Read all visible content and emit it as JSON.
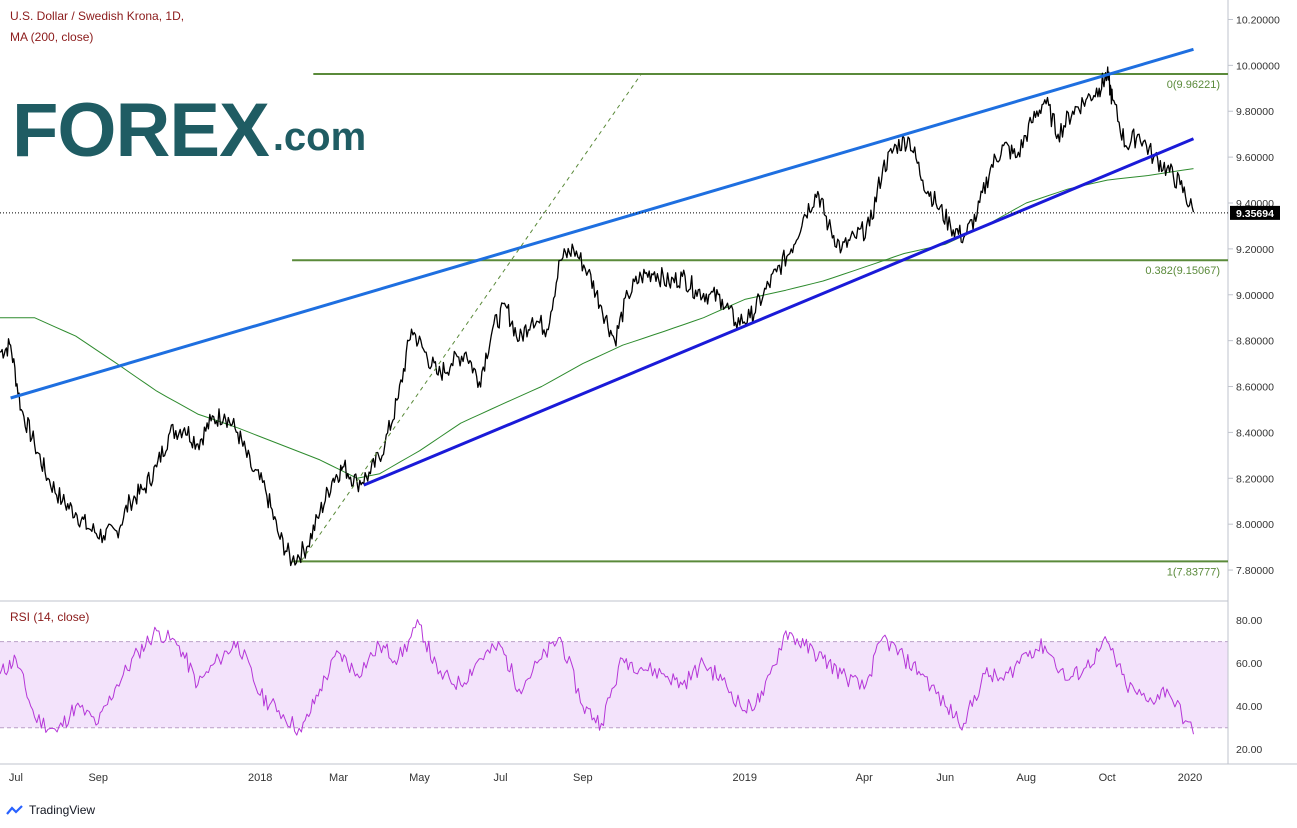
{
  "header": {
    "title": "U.S. Dollar / Swedish Krona, 1D,",
    "indicator": "MA (200, close)",
    "rsi_label": "RSI (14, close)"
  },
  "logo": {
    "big": "FOREX",
    "small": ".com"
  },
  "footer": {
    "brand": "TradingView"
  },
  "colors": {
    "price": "#000000",
    "ma": "#2e8b2e",
    "upper_trend": "#1e6fe0",
    "lower_trend": "#1a1ad8",
    "fib": "#5a8a3a",
    "rsi": "#b536d8",
    "rsi_band": "#f3e3fb",
    "title": "#8b1a1a",
    "logo": "#1f5c63"
  },
  "chart_data": [
    {
      "type": "line",
      "title": "U.S. Dollar / Swedish Krona, 1D,",
      "ylim": [
        7.7,
        10.25
      ],
      "y_ticks": [
        "10.20000",
        "10.00000",
        "9.80000",
        "9.60000",
        "9.40000",
        "9.20000",
        "9.00000",
        "8.80000",
        "8.60000",
        "8.40000",
        "8.20000",
        "8.00000",
        "7.80000"
      ],
      "x_ticks": [
        "Jul",
        "Sep",
        "2018",
        "Mar",
        "May",
        "Jul",
        "Sep",
        "2019",
        "Apr",
        "Jun",
        "Aug",
        "Oct",
        "2020"
      ],
      "last_price": "9.35694",
      "series": [
        {
          "name": "U.S. Dollar / Swedish Krona",
          "x": [
            "2017-06-19",
            "2017-06-27",
            "2017-07-05",
            "2017-07-15",
            "2017-07-25",
            "2017-08-05",
            "2017-08-15",
            "2017-08-25",
            "2017-09-05",
            "2017-09-15",
            "2017-09-25",
            "2017-10-05",
            "2017-10-15",
            "2017-10-25",
            "2017-11-05",
            "2017-11-15",
            "2017-11-25",
            "2017-12-05",
            "2017-12-15",
            "2017-12-25",
            "2018-01-05",
            "2018-01-15",
            "2018-01-25",
            "2018-02-05",
            "2018-02-15",
            "2018-02-25",
            "2018-03-05",
            "2018-03-15",
            "2018-03-25",
            "2018-04-05",
            "2018-04-15",
            "2018-04-25",
            "2018-05-05",
            "2018-05-15",
            "2018-05-25",
            "2018-06-05",
            "2018-06-15",
            "2018-06-25",
            "2018-07-05",
            "2018-07-15",
            "2018-07-25",
            "2018-08-05",
            "2018-08-15",
            "2018-08-25",
            "2018-09-05",
            "2018-09-15",
            "2018-09-25",
            "2018-10-05",
            "2018-10-15",
            "2018-10-25",
            "2018-11-05",
            "2018-11-15",
            "2018-11-25",
            "2018-12-05",
            "2018-12-15",
            "2018-12-25",
            "2019-01-05",
            "2019-01-15",
            "2019-01-25",
            "2019-02-05",
            "2019-02-15",
            "2019-02-25",
            "2019-03-05",
            "2019-03-15",
            "2019-03-25",
            "2019-04-05",
            "2019-04-15",
            "2019-04-25",
            "2019-05-05",
            "2019-05-15",
            "2019-05-25",
            "2019-06-05",
            "2019-06-15",
            "2019-06-25",
            "2019-07-05",
            "2019-07-15",
            "2019-07-25",
            "2019-08-05",
            "2019-08-15",
            "2019-08-25",
            "2019-09-05",
            "2019-09-15",
            "2019-09-25",
            "2019-10-01",
            "2019-10-05",
            "2019-10-15",
            "2019-10-25",
            "2019-11-05",
            "2019-11-15",
            "2019-11-25",
            "2019-12-05"
          ],
          "y": [
            8.75,
            8.78,
            8.5,
            8.35,
            8.2,
            8.1,
            8.05,
            7.98,
            7.95,
            7.97,
            8.1,
            8.15,
            8.25,
            8.4,
            8.42,
            8.35,
            8.45,
            8.48,
            8.4,
            8.25,
            8.15,
            7.95,
            7.84,
            7.9,
            8.05,
            8.2,
            8.25,
            8.18,
            8.22,
            8.35,
            8.55,
            8.85,
            8.75,
            8.65,
            8.7,
            8.75,
            8.62,
            8.85,
            8.95,
            8.8,
            8.9,
            8.85,
            9.15,
            9.2,
            9.1,
            8.95,
            8.8,
            9.0,
            9.08,
            9.1,
            9.05,
            9.08,
            9.02,
            9.0,
            8.98,
            8.88,
            8.9,
            9.0,
            9.1,
            9.2,
            9.35,
            9.45,
            9.3,
            9.2,
            9.25,
            9.3,
            9.55,
            9.65,
            9.68,
            9.5,
            9.4,
            9.3,
            9.25,
            9.35,
            9.55,
            9.65,
            9.6,
            9.75,
            9.85,
            9.7,
            9.8,
            9.85,
            9.9,
            9.96,
            9.85,
            9.65,
            9.7,
            9.6,
            9.55,
            9.48,
            9.36
          ]
        },
        {
          "name": "MA (200, close)",
          "x": [
            "2017-06-19",
            "2017-07-15",
            "2017-08-15",
            "2017-09-15",
            "2017-10-15",
            "2017-11-15",
            "2017-12-15",
            "2018-01-15",
            "2018-02-15",
            "2018-03-15",
            "2018-04-01",
            "2018-05-01",
            "2018-06-01",
            "2018-07-01",
            "2018-08-01",
            "2018-09-01",
            "2018-10-01",
            "2018-11-01",
            "2018-12-01",
            "2019-01-01",
            "2019-02-01",
            "2019-03-01",
            "2019-04-01",
            "2019-05-01",
            "2019-06-01",
            "2019-07-01",
            "2019-08-01",
            "2019-09-01",
            "2019-10-01",
            "2019-11-01",
            "2019-12-05"
          ],
          "y": [
            8.9,
            8.9,
            8.82,
            8.7,
            8.58,
            8.48,
            8.42,
            8.35,
            8.28,
            8.2,
            8.22,
            8.32,
            8.44,
            8.52,
            8.6,
            8.7,
            8.78,
            8.84,
            8.9,
            8.98,
            9.02,
            9.06,
            9.12,
            9.18,
            9.22,
            9.3,
            9.4,
            9.46,
            9.5,
            9.52,
            9.55
          ]
        }
      ],
      "trendlines": [
        {
          "name": "upper",
          "points": [
            [
              "2017-06-27",
              8.55
            ],
            [
              "2019-12-05",
              10.07
            ]
          ]
        },
        {
          "name": "lower",
          "points": [
            [
              "2018-03-20",
              8.17
            ],
            [
              "2019-12-05",
              9.68
            ]
          ]
        },
        {
          "name": "dashed",
          "points": [
            [
              "2018-02-01",
              7.84
            ],
            [
              "2018-10-15",
              9.962
            ]
          ]
        }
      ],
      "fib_levels": [
        {
          "label": "0(9.96221)",
          "value": 9.96221
        },
        {
          "label": "0.382(9.15067)",
          "value": 9.15067
        },
        {
          "label": "1(7.83777)",
          "value": 7.83777
        }
      ]
    },
    {
      "type": "line",
      "title": "RSI (14, close)",
      "ylim": [
        15,
        87
      ],
      "y_ticks": [
        "80.00",
        "60.00",
        "40.00",
        "20.00"
      ],
      "band": [
        30,
        70
      ],
      "series": [
        {
          "name": "RSI (14, close)",
          "x": [
            "2017-06-19",
            "2017-07-01",
            "2017-07-15",
            "2017-08-01",
            "2017-08-15",
            "2017-09-01",
            "2017-09-15",
            "2017-10-01",
            "2017-10-15",
            "2017-11-01",
            "2017-11-15",
            "2017-12-01",
            "2017-12-15",
            "2018-01-01",
            "2018-01-15",
            "2018-02-01",
            "2018-02-15",
            "2018-03-01",
            "2018-03-15",
            "2018-04-01",
            "2018-04-15",
            "2018-05-01",
            "2018-05-15",
            "2018-06-01",
            "2018-06-15",
            "2018-07-01",
            "2018-07-15",
            "2018-08-01",
            "2018-08-15",
            "2018-09-01",
            "2018-09-15",
            "2018-10-01",
            "2018-10-15",
            "2018-11-01",
            "2018-11-15",
            "2018-12-01",
            "2018-12-15",
            "2019-01-01",
            "2019-01-15",
            "2019-02-01",
            "2019-02-15",
            "2019-03-01",
            "2019-03-15",
            "2019-04-01",
            "2019-04-15",
            "2019-05-01",
            "2019-05-15",
            "2019-06-01",
            "2019-06-15",
            "2019-07-01",
            "2019-07-15",
            "2019-08-01",
            "2019-08-15",
            "2019-09-01",
            "2019-09-15",
            "2019-10-01",
            "2019-10-15",
            "2019-11-01",
            "2019-11-15",
            "2019-12-05"
          ],
          "y": [
            55,
            62,
            35,
            28,
            40,
            32,
            50,
            65,
            75,
            68,
            50,
            62,
            70,
            45,
            38,
            28,
            48,
            65,
            55,
            68,
            62,
            78,
            55,
            50,
            62,
            68,
            48,
            62,
            72,
            40,
            32,
            62,
            58,
            55,
            50,
            60,
            52,
            38,
            45,
            75,
            68,
            62,
            55,
            48,
            72,
            62,
            55,
            40,
            32,
            55,
            52,
            65,
            68,
            52,
            58,
            70,
            50,
            42,
            48,
            27
          ]
        }
      ]
    }
  ]
}
